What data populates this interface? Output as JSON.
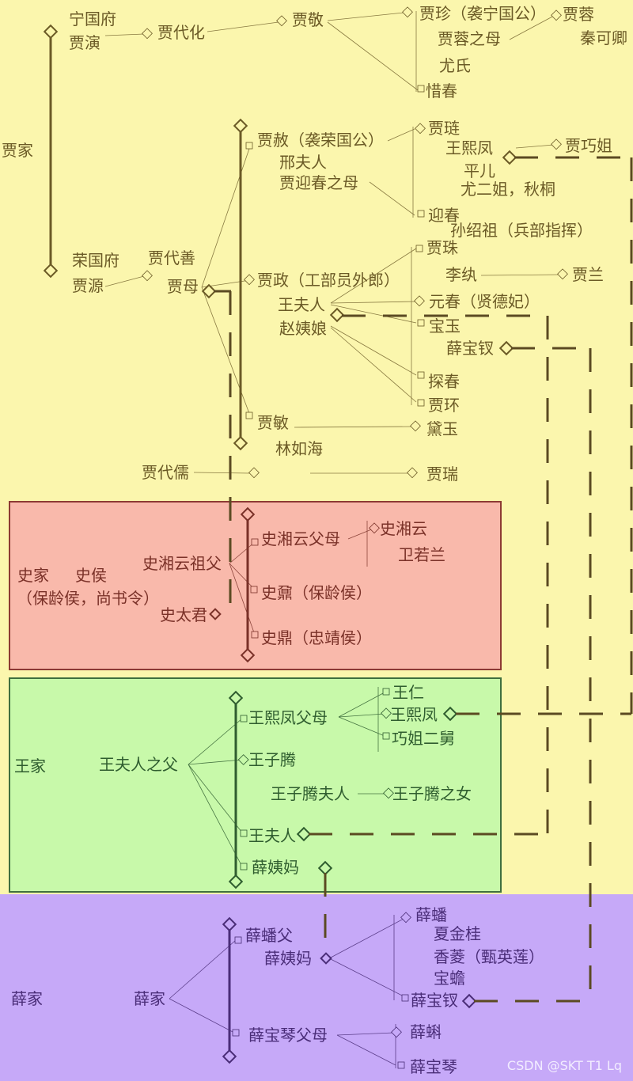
{
  "watermark": "CSDN @SKT T1 Lq",
  "families": {
    "jia": "贾家",
    "shi": "史家",
    "wang": "王家",
    "xue": "薛家"
  },
  "jia": {
    "ningguofu": "宁国府",
    "jiayan": "贾演",
    "jiadaihua": "贾代化",
    "jiajing": "贾敬",
    "jiazhen": "贾珍（袭宁国公）",
    "jiarong_mother": "贾蓉之母",
    "youshi": "尤氏",
    "xichun": "惜春",
    "jiarong": "贾蓉",
    "qinkeqing": "秦可卿",
    "rongguofu": "荣国府",
    "jiayuan": "贾源",
    "jiadaishan": "贾代善",
    "jiamu": "贾母",
    "jiashe": "贾赦（袭荣国公）",
    "xingfuren": "邢夫人",
    "yingchun_mother": "贾迎春之母",
    "jialian": "贾琏",
    "wangxifeng": "王熙凤",
    "pinger": "平儿",
    "youerjie": "尤二姐，秋桐",
    "jiaqiaojie": "贾巧姐",
    "yingchun": "迎春",
    "sunshaozu": "孙绍祖（兵部指挥）",
    "jiazheng": "贾政（工部员外郎）",
    "wangfuren": "王夫人",
    "zhaoyiniang": "赵姨娘",
    "jiazhu": "贾珠",
    "liwan": "李纨",
    "jialan": "贾兰",
    "yuanchun": "元春（贤德妃）",
    "baoyu": "宝玉",
    "xuebaochai": "薛宝钗",
    "tanchun": "探春",
    "jiahuan": "贾环",
    "jiamin": "贾敏",
    "linruhai": "林如海",
    "daiyu": "黛玉",
    "jiadairu": "贾代儒",
    "jiarui": "贾瑞"
  },
  "shi": {
    "shihou": "史侯",
    "shihou_title": "（保龄侯，尚书令）",
    "xiangyun_grandfather": "史湘云祖父",
    "shitaijun": "史太君",
    "xiangyun_parents": "史湘云父母",
    "shixiangyun": "史湘云",
    "weiruolan": "卫若兰",
    "shinai": "史鼐（保龄侯）",
    "shiding": "史鼎（忠靖侯）"
  },
  "wang": {
    "wangfuren_father": "王夫人之父",
    "xifeng_parents": "王熙凤父母",
    "wangren": "王仁",
    "wangxifeng": "王熙凤",
    "qiaojie_uncle": "巧姐二舅",
    "wangziteng": "王子腾",
    "ziteng_wife": "王子腾夫人",
    "ziteng_daughter": "王子腾之女",
    "wangfuren": "王夫人",
    "xueyima": "薛姨妈"
  },
  "xue": {
    "xue_family": "薛家",
    "xuepan_father": "薛蟠父",
    "xueyima": "薛姨妈",
    "xuepan": "薛蟠",
    "xiajingui": "夏金桂",
    "xiangling": "香菱（甄英莲）",
    "baochan": "宝蟾",
    "xuebaochai": "薛宝钗",
    "baoqin_parents": "薛宝琴父母",
    "xueke": "薛蝌",
    "xuebaoqin": "薛宝琴"
  },
  "colors": {
    "jia_bg": "#fbf6ad",
    "shi_bg": "#f9b9ab",
    "wang_bg": "#c8f9aa",
    "xue_bg": "#c6a9f8",
    "jia_line": "#6b5a26",
    "shi_line": "#7a3128",
    "wang_line": "#2f5d2f",
    "xue_line": "#4a2d78"
  }
}
